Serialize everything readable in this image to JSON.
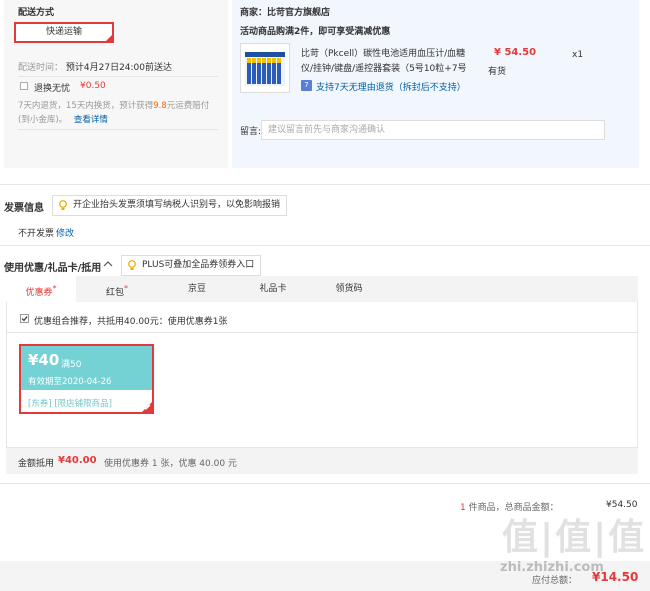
{
  "shipping": {
    "title": "配送方式",
    "method": "快递运输",
    "time_label": "配送时间：",
    "time_value": "预计4月27日24:00前送达",
    "insurance_label": "退换无忧",
    "insurance_price": "¥0.50",
    "insurance_desc_1": "7天内退货，15天内换货，预计获得",
    "insurance_desc_num": "9.8",
    "insurance_desc_2": "元运费赔付",
    "insurance_desc_3": "(到小金库)。",
    "insurance_link": "查看详情"
  },
  "store": {
    "label": "商家：比苛官方旗舰店",
    "promo": "活动商品购满2件，即可享受满减优惠",
    "product_name_1": "比苛（Pkcell）碳性电池适用血压计/血糖",
    "product_name_2": "仪/挂钟/键盘/遥控器套装（5号10粒+7号",
    "price": "¥ 54.50",
    "stock": "有货",
    "qty": "x1",
    "return_badge": "7",
    "return_text": "支持7天无理由退货（拆封后不支持）",
    "note_label": "留言:",
    "note_placeholder": "建议留言前先与商家沟通确认"
  },
  "invoice": {
    "title": "发票信息",
    "tip": "开企业抬头发票须填写纳税人识别号，以免影响报销",
    "value": "不开发票",
    "edit": "修改"
  },
  "discount": {
    "title": "使用优惠/礼品卡/抵用",
    "plus_tip": "PLUS可叠加全品券领券入口",
    "tabs": [
      {
        "label": "优惠券",
        "star": "*"
      },
      {
        "label": "红包",
        "star": "*"
      },
      {
        "label": "京豆",
        "star": ""
      },
      {
        "label": "礼品卡",
        "star": ""
      },
      {
        "label": "领货码",
        "star": ""
      }
    ],
    "combo_text": "优惠组合推荐，共抵用40.00元：使用优惠券1张",
    "coupon": {
      "amount": "¥40",
      "condition": "满50",
      "expiry": "有效期至2020-04-26",
      "tag1": "[东券]",
      "tag2": "[限店铺限商品]"
    },
    "summary_label": "金额抵用",
    "summary_amount": "¥40.00",
    "summary_desc": "使用优惠券 1 张，优惠 40.00 元"
  },
  "totals": {
    "count": "1",
    "count_text": "件商品，总商品金额：",
    "amount": "¥54.50",
    "due_label": "应付总额：",
    "due_amount": "¥14.50"
  },
  "watermark": {
    "big": "值|值|值",
    "url": "zhi.zhizhi.com"
  },
  "colors": {
    "accent": "#e4393c",
    "coupon": "#74d2d4",
    "link": "#005ea7"
  }
}
